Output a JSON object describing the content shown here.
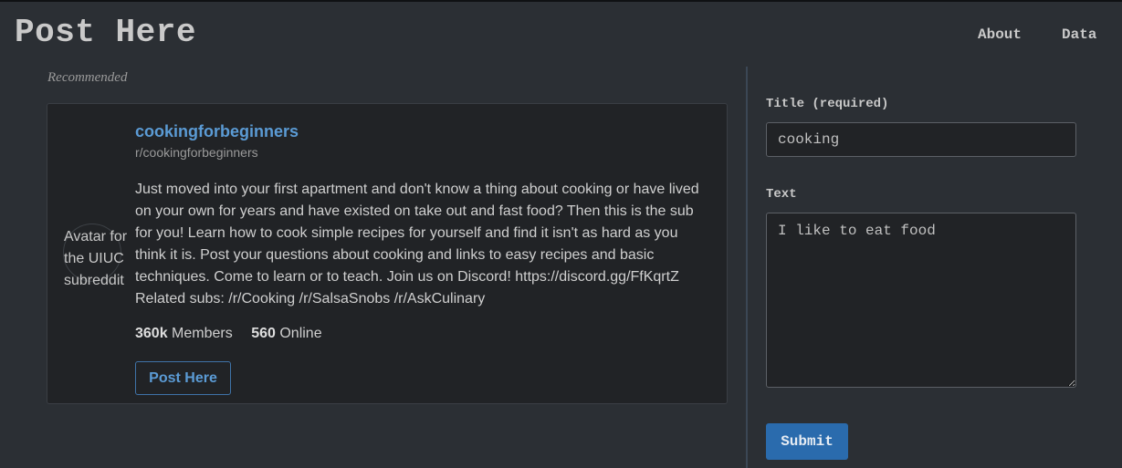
{
  "header": {
    "brand": "Post Here",
    "nav": [
      {
        "label": "About"
      },
      {
        "label": "Data"
      }
    ]
  },
  "recommended": {
    "section_label": "Recommended",
    "card": {
      "avatar_alt": "Avatar for the UIUC subreddit",
      "name": "cookingforbeginners",
      "handle": "r/cookingforbeginners",
      "description": "Just moved into your first apartment and don't know a thing about cooking or have lived on your own for years and have existed on take out and fast food? Then this is the sub for you! Learn how to cook simple recipes for yourself and find it isn't as hard as you think it is. Post your questions about cooking and links to easy recipes and basic techniques. Come to learn or to teach. Join us on Discord! https://discord.gg/FfKqrtZ Related subs: /r/Cooking /r/SalsaSnobs /r/AskCulinary",
      "members_count": "360k",
      "members_label": "Members",
      "online_count": "560",
      "online_label": "Online",
      "post_button": "Post Here"
    }
  },
  "form": {
    "title_label": "Title (required)",
    "title_value": "cooking",
    "text_label": "Text",
    "text_value": "I like to eat food",
    "submit_label": "Submit"
  },
  "colors": {
    "background": "#2b2f34",
    "card": "#212326",
    "accent": "#5b9bd5",
    "submit": "#2a6bad"
  }
}
